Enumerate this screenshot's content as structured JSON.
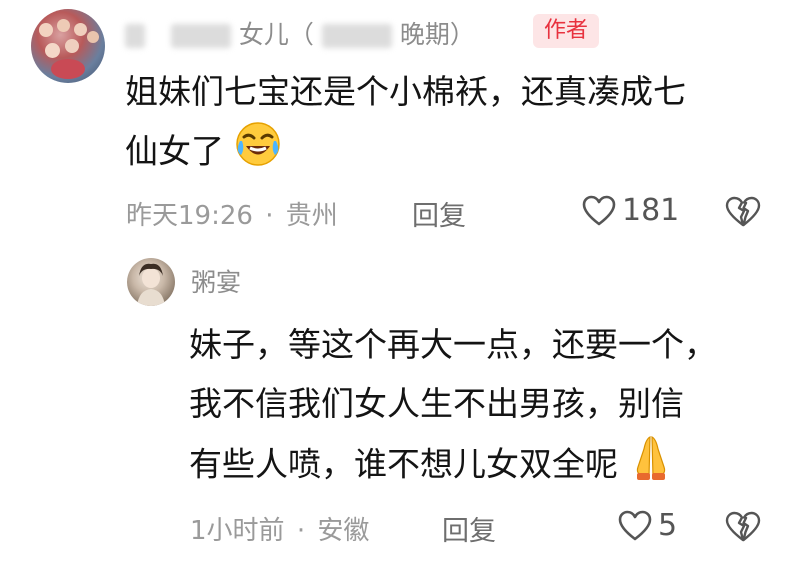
{
  "comment": {
    "author_name": "女儿（",
    "author_name_tail": "晚期）",
    "author_badge": "作者",
    "text_line1": "姐妹们七宝还是个小棉袄，还真凑成七",
    "text_line2": "仙女了",
    "emoji": "laughing-crying-emoji",
    "time": "昨天19:26",
    "location": "贵州",
    "reply_label": "回复",
    "like_count": "181"
  },
  "reply": {
    "author_name": "粥宴",
    "text_line1": "妹子，等这个再大一点，还要一个，",
    "text_line2": "我不信我们女人生不出男孩，别信",
    "text_line3": "有些人喷，谁不想儿女双全呢",
    "emoji": "praying-hands-emoji",
    "time": "1小时前",
    "location": "安徽",
    "reply_label": "回复",
    "like_count": "5"
  },
  "separator": "·",
  "colors": {
    "badge_text": "#e8323f",
    "badge_bg": "#fde5e6",
    "meta_gray": "#9a9a9a"
  }
}
